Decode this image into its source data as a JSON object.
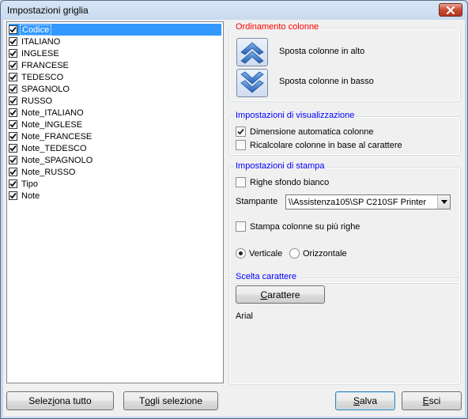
{
  "window": {
    "title": "Impostazioni griglia"
  },
  "columns_list": {
    "items": [
      {
        "label": "Codice",
        "checked": true,
        "selected": true
      },
      {
        "label": "ITALIANO",
        "checked": true
      },
      {
        "label": "INGLESE",
        "checked": true
      },
      {
        "label": "FRANCESE",
        "checked": true
      },
      {
        "label": "TEDESCO",
        "checked": true
      },
      {
        "label": "SPAGNOLO",
        "checked": true
      },
      {
        "label": "RUSSO",
        "checked": true
      },
      {
        "label": "Note_ITALIANO",
        "checked": true
      },
      {
        "label": "Note_INGLESE",
        "checked": true
      },
      {
        "label": "Note_FRANCESE",
        "checked": true
      },
      {
        "label": "Note_TEDESCO",
        "checked": true
      },
      {
        "label": "Note_SPAGNOLO",
        "checked": true
      },
      {
        "label": "Note_RUSSO",
        "checked": true
      },
      {
        "label": "Tipo",
        "checked": true
      },
      {
        "label": "Note",
        "checked": true
      }
    ]
  },
  "ordering": {
    "title": "Ordinamento colonne",
    "title_color": "#ff0000",
    "move_up_label": "Sposta colonne in alto",
    "move_down_label": "Sposta colonne in basso"
  },
  "display": {
    "title": "Impostazioni di visualizzazione",
    "title_color": "#0000ff",
    "auto_size_label": "Dimensione automatica colonne",
    "auto_size_checked": true,
    "recalc_label": "Ricalcolare colonne in base al carattere",
    "recalc_checked": false
  },
  "print": {
    "title": "Impostazioni di stampa",
    "title_color": "#0000ff",
    "white_rows_label": "Righe sfondo bianco",
    "white_rows_checked": false,
    "printer_label": "Stampante",
    "printer_value": "\\\\Assistenza105\\SP C210SF Printer",
    "multi_row_label": "Stampa colonne su più righe",
    "multi_row_checked": false,
    "vertical_label": "Verticale",
    "horizontal_label": "Orizzontale",
    "orientation": "Verticale"
  },
  "font": {
    "title": "Scelta carattere",
    "title_color": "#0000ff",
    "button_first": "C",
    "button_rest": "arattere",
    "current_font": "Arial"
  },
  "footer": {
    "select_all_pre": "Selez",
    "select_all_u": "i",
    "select_all_post": "ona tutto",
    "deselect_pre": "T",
    "deselect_u": "o",
    "deselect_post": "gli selezione",
    "save_u": "S",
    "save_post": "alva",
    "exit_u": "E",
    "exit_post": "sci"
  },
  "icons": {
    "close": "close-icon",
    "check": "check-icon",
    "arrow_up": "double-chevron-up-icon",
    "arrow_down": "double-chevron-down-icon",
    "dropdown": "chevron-down-icon"
  }
}
